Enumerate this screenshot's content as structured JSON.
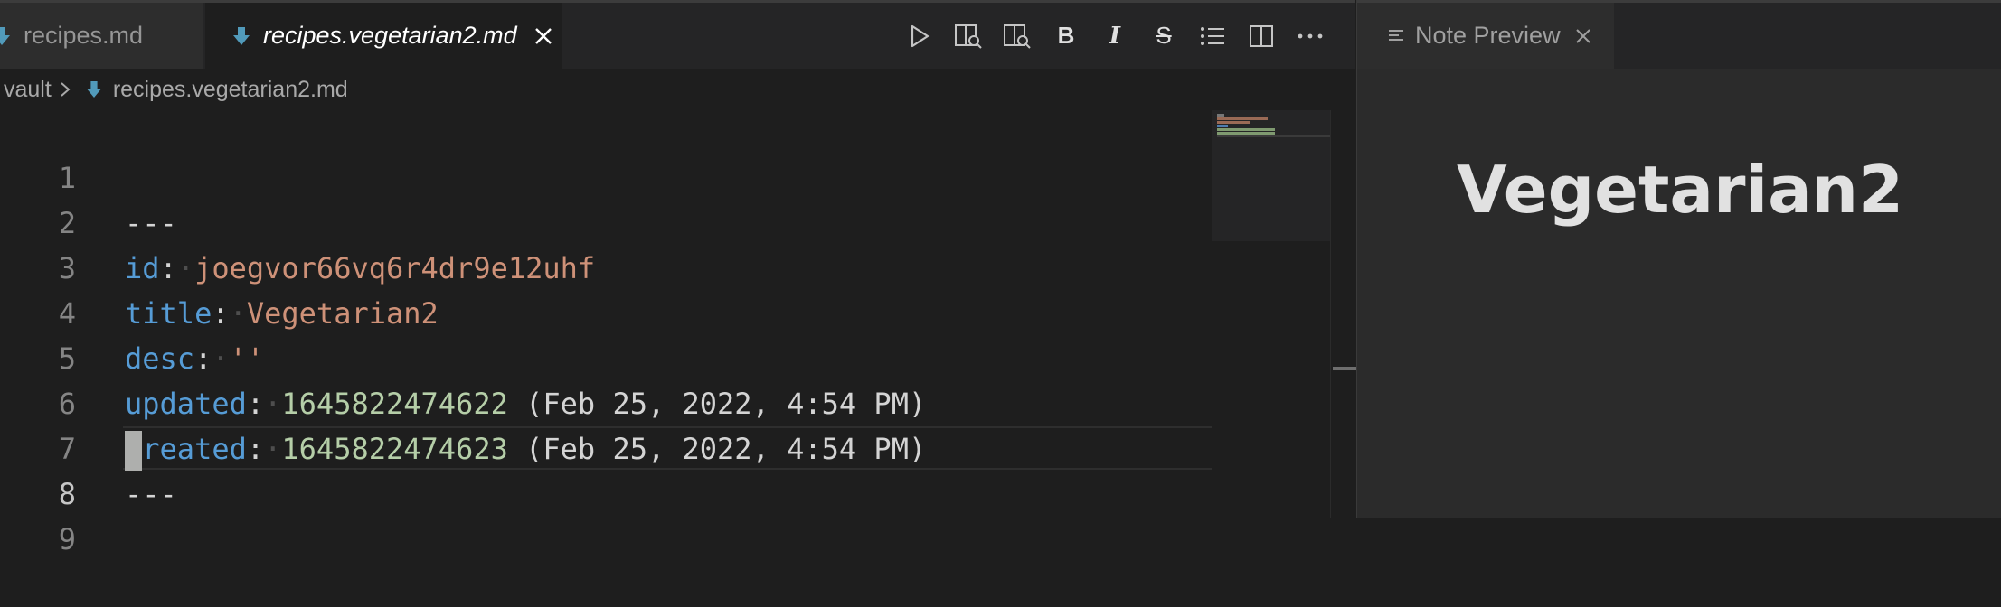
{
  "editor": {
    "tabs": [
      {
        "label": "recipes.md",
        "active": false
      },
      {
        "label": "recipes.vegetarian2.md",
        "active": true
      }
    ],
    "toolbar": [
      {
        "name": "run-icon"
      },
      {
        "name": "open-preview-icon"
      },
      {
        "name": "open-preview-side-icon"
      },
      {
        "name": "bold",
        "label": "B"
      },
      {
        "name": "italic",
        "label": "I"
      },
      {
        "name": "strikethrough",
        "label": "S"
      },
      {
        "name": "list-icon"
      },
      {
        "name": "split-editor-icon"
      },
      {
        "name": "more-actions-icon"
      }
    ],
    "breadcrumb": {
      "root": "vault",
      "file": "recipes.vegetarian2.md"
    },
    "line_numbers": [
      "1",
      "2",
      "3",
      "4",
      "5",
      "6",
      "7",
      "8",
      "9"
    ],
    "current_line": "8",
    "lines": {
      "l1": "---",
      "l2_key": "id",
      "l2_val": "joegvor66vq6r4dr9e12uhf",
      "l3_key": "title",
      "l3_val": "Vegetarian2",
      "l4_key": "desc",
      "l4_val": "''",
      "l5_key": "updated",
      "l5_num": "1645822474622",
      "l5_hint": "(Feb 25, 2022, 4:54 PM)",
      "l6_key": "created",
      "l6_num": "1645822474623",
      "l6_hint": "(Feb 25, 2022, 4:54 PM)",
      "l7": "---"
    }
  },
  "preview": {
    "tab_label": "Note Preview",
    "title": "Vegetarian2"
  },
  "colors": {
    "keyword": "#569cd6",
    "string": "#ce9178",
    "number": "#b5cea8",
    "markdown_icon": "#519aba"
  }
}
